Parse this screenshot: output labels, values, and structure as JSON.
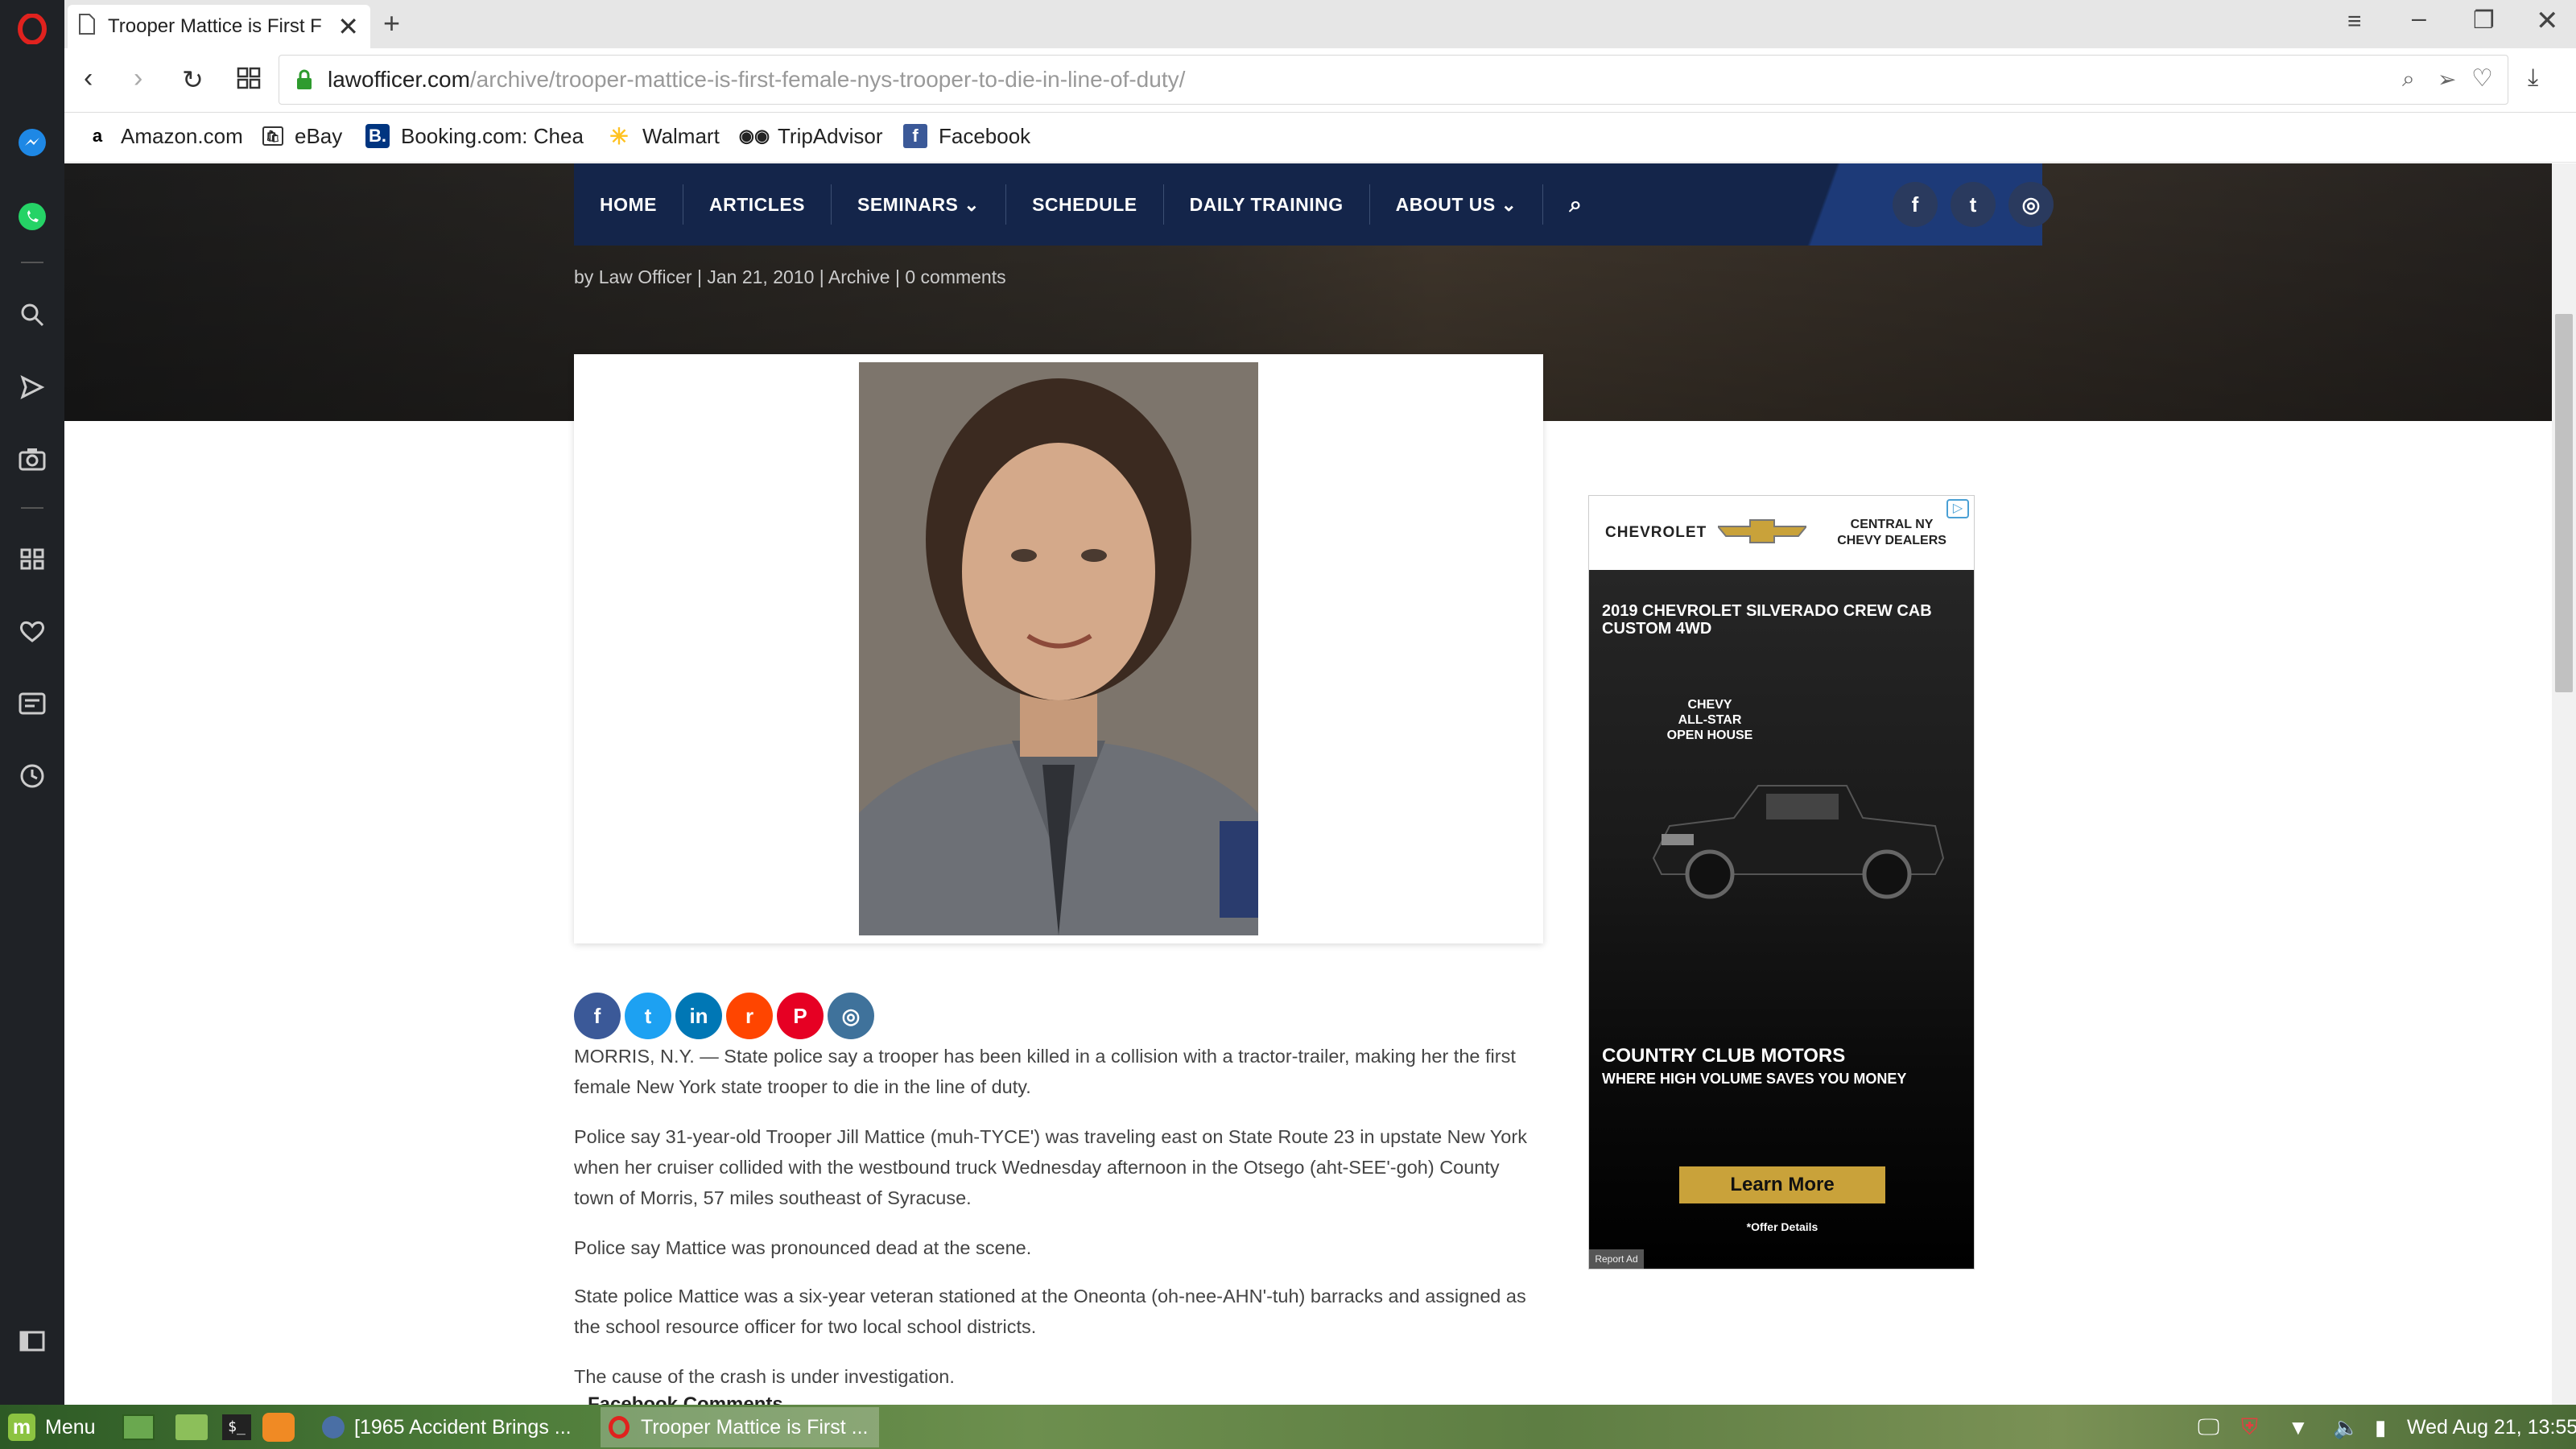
{
  "browser": {
    "tab_title": "Trooper Mattice is First F",
    "url_domain": "lawofficer.com",
    "url_path": "/archive/trooper-mattice-is-first-female-nys-trooper-to-die-in-line-of-duty/",
    "bookmarks": [
      {
        "label": "Amazon.com",
        "icon": "amazon-icon"
      },
      {
        "label": "eBay",
        "icon": "ebay-icon"
      },
      {
        "label": "Booking.com: Chea",
        "icon": "booking-icon"
      },
      {
        "label": "Walmart",
        "icon": "walmart-icon"
      },
      {
        "label": "TripAdvisor",
        "icon": "tripadvisor-icon"
      },
      {
        "label": "Facebook",
        "icon": "facebook-icon"
      }
    ]
  },
  "site": {
    "nav": [
      {
        "label": "HOME"
      },
      {
        "label": "ARTICLES"
      },
      {
        "label": "SEMINARS ⌄"
      },
      {
        "label": "SCHEDULE"
      },
      {
        "label": "DAILY TRAINING"
      },
      {
        "label": "ABOUT US ⌄"
      }
    ],
    "social": {
      "facebook": "f",
      "twitter": "t",
      "instagram": "◎"
    }
  },
  "article": {
    "meta": {
      "prefix": "by",
      "author": "Law Officer",
      "date": "Jan 21, 2010",
      "category": "Archive",
      "comments": "0 comments"
    },
    "share_icons": [
      {
        "name": "facebook",
        "glyph": "f",
        "color": "#3b5998"
      },
      {
        "name": "twitter",
        "glyph": "t",
        "color": "#1da1f2"
      },
      {
        "name": "linkedin",
        "glyph": "in",
        "color": "#0077b5"
      },
      {
        "name": "reddit",
        "glyph": "r",
        "color": "#ff4500"
      },
      {
        "name": "pinterest",
        "glyph": "P",
        "color": "#e60023"
      },
      {
        "name": "instagram",
        "glyph": "◎",
        "color": "#3f729b"
      }
    ],
    "paragraphs": [
      "MORRIS, N.Y. — State police say a trooper has been killed in a collision with a tractor-trailer, making her the first female New York state trooper to die in the line of duty.",
      "Police say 31-year-old Trooper Jill Mattice (muh-TYCE') was traveling east on State Route 23 in upstate New York when her cruiser collided with the westbound truck Wednesday afternoon in the Otsego (aht-SEE'-goh) County town of Morris, 57 miles southeast of Syracuse.",
      "Police say Mattice was pronounced dead at the scene.",
      "State police Mattice was a six-year veteran stationed at the Oneonta (oh-nee-AHN'-tuh) barracks and assigned as the school resource officer for two local school districts.",
      "The cause of the crash is under investigation."
    ],
    "fb_comments_label": "Facebook Comments"
  },
  "ad": {
    "brand": "CHEVROLET",
    "dealer": "CENTRAL NY\nCHEVY DEALERS",
    "headline": "2019 CHEVROLET SILVERADO CREW CAB CUSTOM 4WD",
    "event": "CHEVY\nALL-STAR\nOPEN HOUSE",
    "dealer_name": "COUNTRY CLUB MOTORS",
    "tagline": "WHERE HIGH VOLUME SAVES YOU MONEY",
    "cta": "Learn More",
    "disclaimer": "*Offer Details",
    "report": "Report Ad"
  },
  "taskbar": {
    "menu_label": "Menu",
    "window1": "[1965 Accident Brings ...",
    "window2": "Trooper Mattice is First ...",
    "clock": "Wed Aug 21, 13:55"
  },
  "colors": {
    "nav_bg": "#14254a",
    "ad_cta": "#c9a23a",
    "opera_red": "#e0221e"
  }
}
